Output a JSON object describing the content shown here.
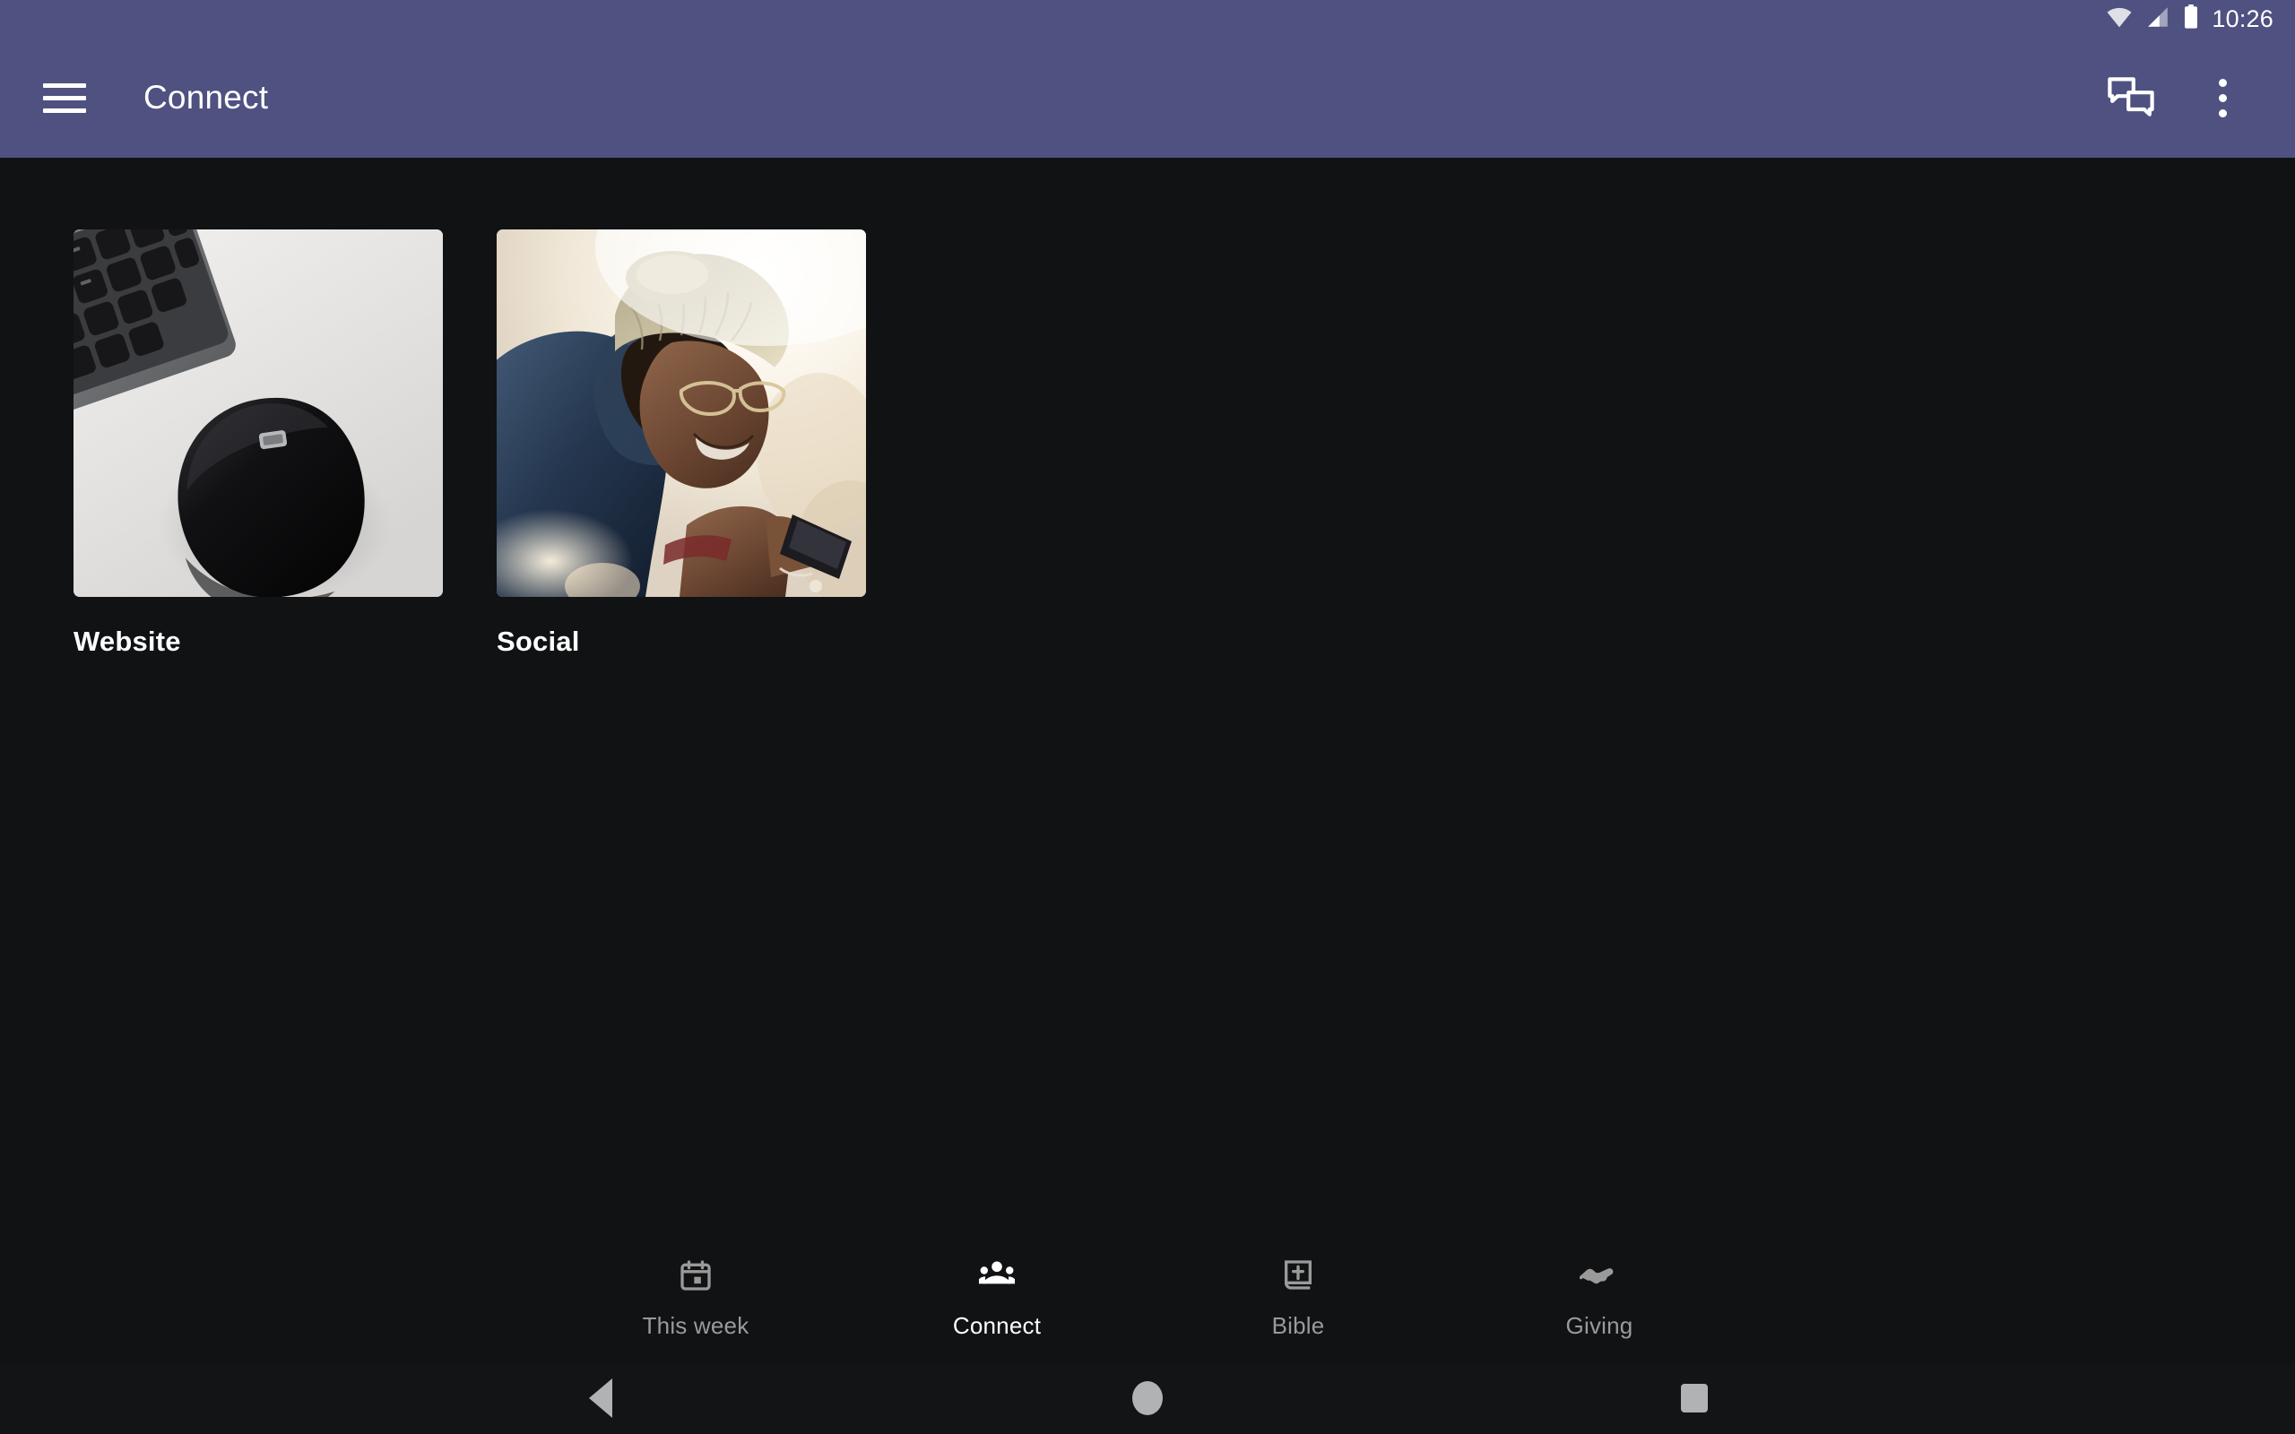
{
  "status_bar": {
    "time": "10:26",
    "icons": [
      "wifi-icon",
      "cell-signal-icon",
      "battery-icon"
    ]
  },
  "app_bar": {
    "title": "Connect",
    "menu_icon": "hamburger-menu-icon",
    "actions": [
      {
        "name": "forum-icon",
        "label": "Messages"
      },
      {
        "name": "overflow-menu-icon",
        "label": "More options"
      }
    ],
    "background_color": "#4F5181"
  },
  "theme": {
    "background_color": "#111214",
    "accent_color": "#4F5181",
    "active_nav_color": "#FFFFFF",
    "inactive_nav_color": "#9A9A9A"
  },
  "content": {
    "cards": [
      {
        "label": "Website",
        "image_alt": "Black wireless mouse beside a keyboard on a white desk"
      },
      {
        "label": "Social",
        "image_alt": "Person in knit hat and navy puffer jacket smiling at a phone in bright sunlight"
      }
    ]
  },
  "bottom_nav": {
    "items": [
      {
        "label": "This week",
        "icon": "calendar-icon",
        "active": false
      },
      {
        "label": "Connect",
        "icon": "groups-icon",
        "active": true
      },
      {
        "label": "Bible",
        "icon": "book-cross-icon",
        "active": false
      },
      {
        "label": "Giving",
        "icon": "hand-heart-icon",
        "active": false
      }
    ]
  },
  "system_nav": {
    "back": "back-triangle-icon",
    "home": "home-circle-icon",
    "recents": "recents-square-icon"
  }
}
